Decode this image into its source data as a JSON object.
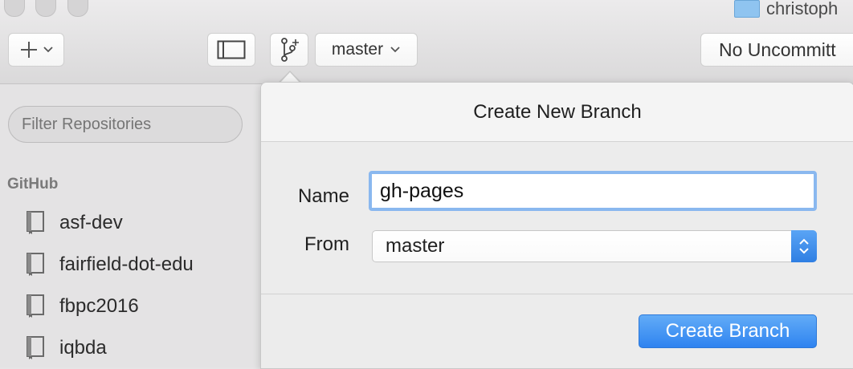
{
  "window": {
    "title": "christoph"
  },
  "toolbar": {
    "branch_select_label": "master",
    "uncommitted_label": "No Uncommitt"
  },
  "sidebar": {
    "filter_placeholder": "Filter Repositories",
    "section_header": "GitHub",
    "repos": [
      {
        "label": "asf-dev"
      },
      {
        "label": "fairfield-dot-edu"
      },
      {
        "label": "fbpc2016"
      },
      {
        "label": "iqbda"
      }
    ]
  },
  "popover": {
    "title": "Create New Branch",
    "name_label": "Name",
    "name_value": "gh-pages",
    "from_label": "From",
    "from_value": "master",
    "create_button_label": "Create Branch"
  },
  "colors": {
    "accent": "#2f83f0",
    "focus_ring": "#8ab8ef",
    "folder": "#8fc4f0"
  }
}
